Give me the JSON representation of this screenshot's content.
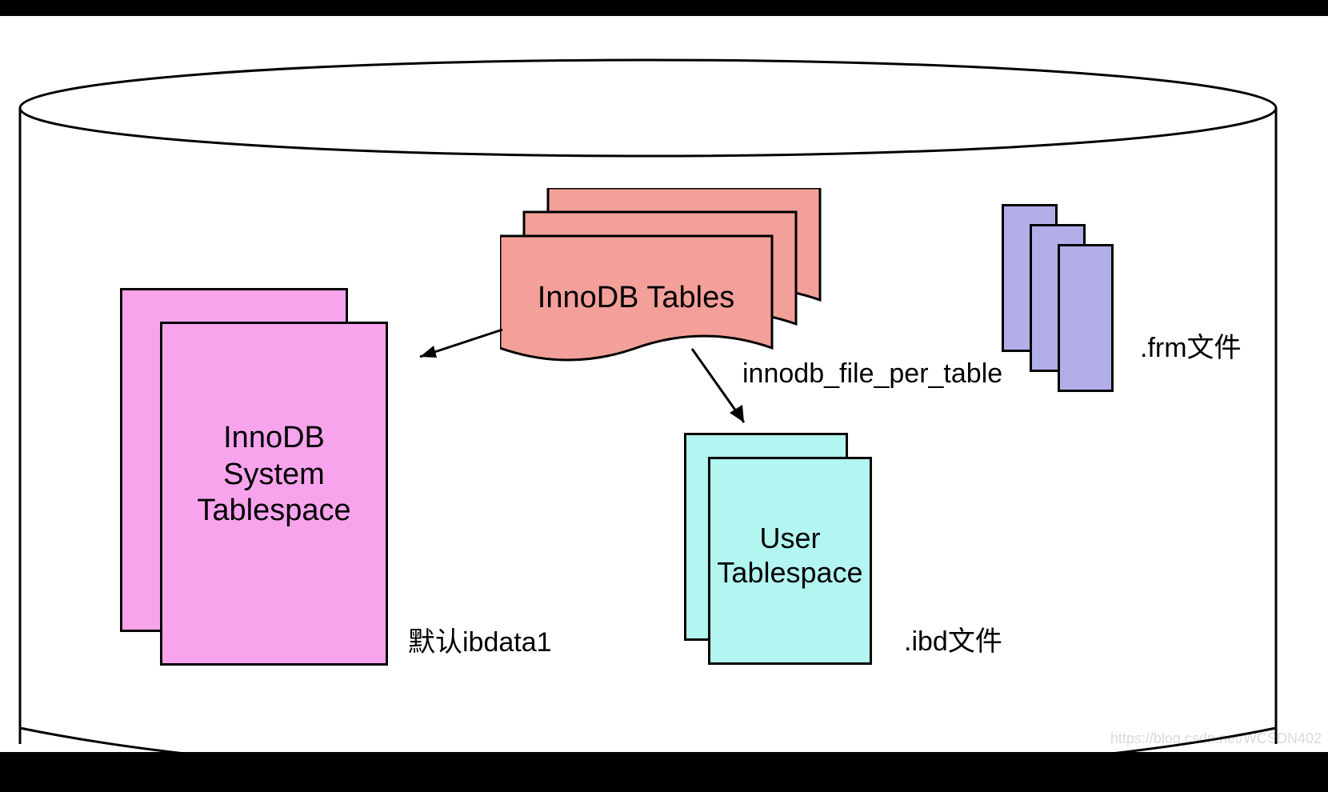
{
  "innodb_tables_label": "InnoDB Tables",
  "system_tablespace_label": "InnoDB\nSystem\nTablespace",
  "system_tablespace_caption": "默认ibdata1",
  "user_tablespace_label": "User\nTablespace",
  "user_tablespace_caption": ".ibd文件",
  "option_label": "innodb_file_per_table",
  "frm_label": ".frm文件",
  "watermark": "https://blog.csdn.net/WCSDN402"
}
